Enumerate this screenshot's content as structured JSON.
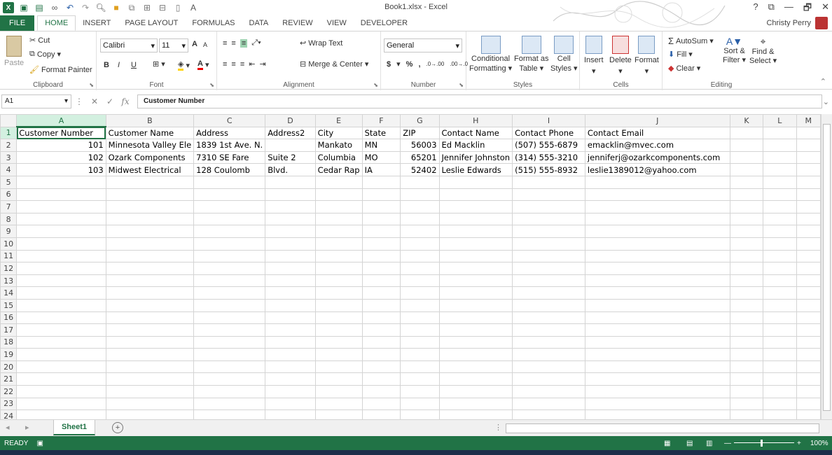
{
  "window": {
    "title": "Book1.xlsx - Excel"
  },
  "qat": {
    "icons": [
      "excel-logo",
      "save",
      "save-as",
      "infinity",
      "undo",
      "redo",
      "print-preview",
      "open",
      "format",
      "sort",
      "insert",
      "document",
      "font-color"
    ]
  },
  "window_controls": {
    "help": "?",
    "restore": "⧉",
    "minimize": "—",
    "maximize": "🗗",
    "close": "✕"
  },
  "tabs": [
    "FILE",
    "HOME",
    "INSERT",
    "PAGE LAYOUT",
    "FORMULAS",
    "DATA",
    "REVIEW",
    "VIEW",
    "DEVELOPER"
  ],
  "active_tab": "HOME",
  "user": {
    "name": "Christy Perry"
  },
  "ribbon": {
    "clipboard": {
      "label": "Clipboard",
      "paste": "Paste",
      "cut": "Cut",
      "copy": "Copy",
      "format_painter": "Format Painter"
    },
    "font": {
      "label": "Font",
      "font_name": "Calibri",
      "font_size": "11",
      "bold": "B",
      "italic": "I",
      "underline": "U",
      "grow": "A",
      "shrink": "A"
    },
    "alignment": {
      "label": "Alignment",
      "wrap_text": "Wrap Text",
      "merge_center": "Merge & Center"
    },
    "number": {
      "label": "Number",
      "format": "General",
      "currency": "$",
      "percent": "%",
      "comma": ","
    },
    "styles": {
      "label": "Styles",
      "conditional": "Conditional",
      "formatting": "Formatting",
      "format_as": "Format as",
      "table": "Table",
      "cell": "Cell",
      "styles": "Styles"
    },
    "cells": {
      "label": "Cells",
      "insert": "Insert",
      "delete": "Delete",
      "format": "Format"
    },
    "editing": {
      "label": "Editing",
      "autosum": "AutoSum",
      "fill": "Fill",
      "clear": "Clear",
      "sort_filter": "Sort &",
      "filter": "Filter",
      "find_select": "Find &",
      "select": "Select"
    }
  },
  "formula_bar": {
    "name_box": "A1",
    "cancel": "✕",
    "enter": "✓",
    "fx": "fx",
    "content": "Customer Number"
  },
  "grid": {
    "columns": [
      "A",
      "B",
      "C",
      "D",
      "E",
      "F",
      "G",
      "H",
      "I",
      "J",
      "K",
      "L",
      "M"
    ],
    "header_row": [
      "Customer Number",
      "Customer Name",
      "Address",
      "Address2",
      "City",
      "State",
      "ZIP",
      "Contact Name",
      "Contact Phone",
      "Contact Email",
      "",
      "",
      ""
    ],
    "rows": [
      [
        "101",
        "Minnesota Valley Ele",
        "1839 1st Ave. N.",
        "",
        "Mankato",
        "MN",
        "56003",
        "Ed Macklin",
        "(507) 555-6879",
        "emacklin@mvec.com",
        "",
        "",
        ""
      ],
      [
        "102",
        "Ozark Components",
        "7310 SE Fare",
        "Suite 2",
        "Columbia",
        "MO",
        "65201",
        "Jennifer Johnston",
        "(314) 555-3210",
        "jenniferj@ozarkcomponents.com",
        "",
        "",
        ""
      ],
      [
        "103",
        "Midwest Electrical",
        "128 Coulomb",
        "Blvd.",
        "Cedar Rap",
        "IA",
        "52402",
        "Leslie Edwards",
        "(515) 555-8932",
        "leslie1389012@yahoo.com",
        "",
        "",
        ""
      ]
    ],
    "row_numbers": [
      "1",
      "2",
      "3",
      "4",
      "5",
      "6",
      "7",
      "8",
      "9",
      "10",
      "11",
      "12",
      "13",
      "14",
      "15",
      "16",
      "17",
      "18",
      "19",
      "20",
      "21",
      "22",
      "23",
      "24"
    ]
  },
  "sheet_tabs": {
    "active": "Sheet1",
    "add": "+"
  },
  "status_bar": {
    "mode": "READY",
    "zoom": "100%"
  },
  "colors": {
    "accent": "#217346",
    "gridline": "#d4d4d4"
  }
}
